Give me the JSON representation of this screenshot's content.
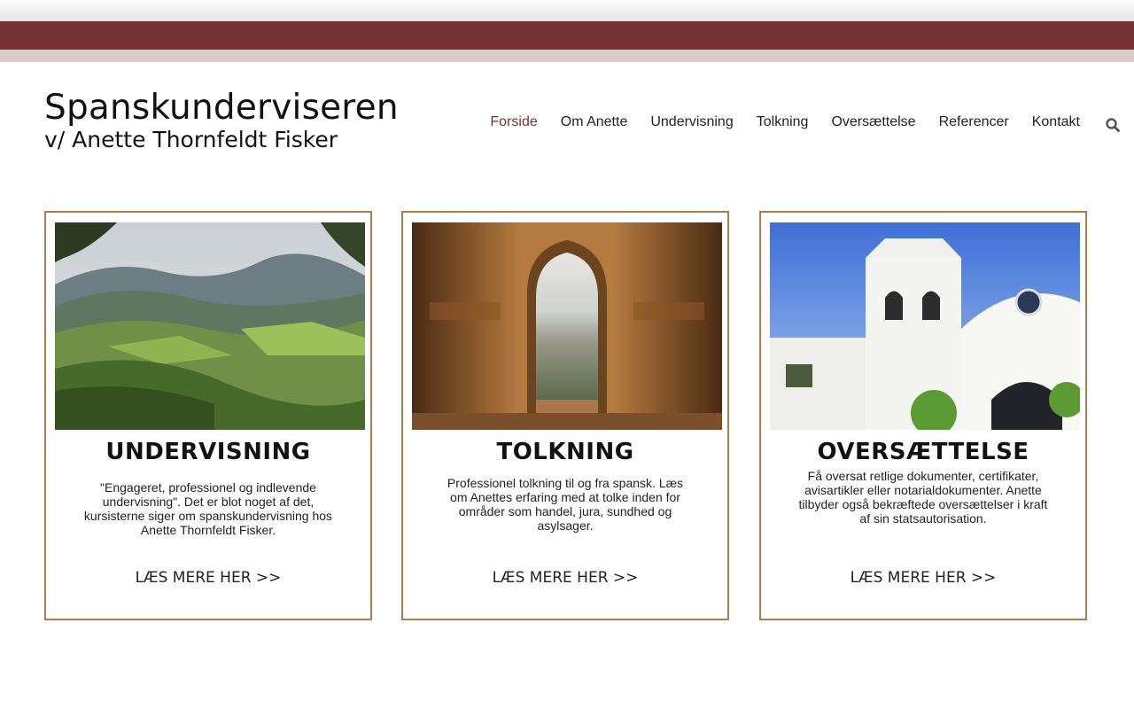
{
  "brand": {
    "title": "Spanskunderviseren",
    "subtitle": "v/ Anette Thornfeldt Fisker"
  },
  "nav": {
    "items": [
      {
        "label": "Forside",
        "active": true
      },
      {
        "label": "Om Anette",
        "active": false
      },
      {
        "label": "Undervisning",
        "active": false
      },
      {
        "label": "Tolkning",
        "active": false
      },
      {
        "label": "Oversættelse",
        "active": false
      },
      {
        "label": "Referencer",
        "active": false
      },
      {
        "label": "Kontakt",
        "active": false
      }
    ],
    "search_icon": "search-icon"
  },
  "colors": {
    "accent": "#763232",
    "band": "#d9cdc7",
    "card_border": "#b07c4c"
  },
  "cards": [
    {
      "heading": "UNDERVISNING",
      "description": "\"Engageret, professionel og indlevende undervisning\". Det er blot noget af det, kursisterne siger om spanskundervisning hos Anette Thornfeldt Fisker.",
      "link": "LÆS MERE HER >>"
    },
    {
      "heading": "TOLKNING",
      "description": "Professionel tolkning til og fra spansk. Læs om Anettes erfaring med at tolke inden for områder som handel, jura, sundhed og asylsager.",
      "link": "LÆS MERE HER >>"
    },
    {
      "heading": "OVERSÆTTELSE",
      "description": "Få oversat retlige dokumenter, certifikater, avisartikler eller notarialdokumenter. Anette tilbyder også bekræftede oversættelser i kraft af sin statsautorisation.",
      "link": "LÆS MERE HER >>"
    }
  ]
}
